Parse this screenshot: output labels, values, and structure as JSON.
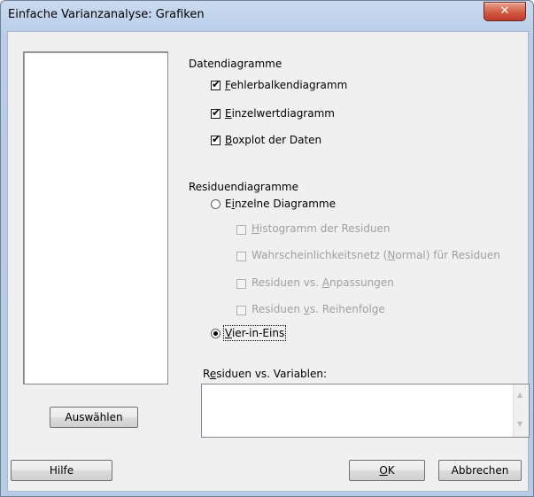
{
  "window": {
    "title": "Einfache Varianzanalyse: Grafiken",
    "close_glyph": "✕"
  },
  "data_plots": {
    "heading": "Datendiagramme",
    "items": [
      {
        "mnemonic": "F",
        "rest": "ehlerbalkendiagramm",
        "checked": true
      },
      {
        "mnemonic": "E",
        "rest": "inzelwertdiagramm",
        "checked": true
      },
      {
        "mnemonic": "B",
        "rest": "oxplot der Daten",
        "checked": true
      }
    ]
  },
  "residual_plots": {
    "heading": "Residuendiagramme",
    "individual": {
      "mnemonic": "i",
      "pre": "E",
      "rest": "nzelne Diagramme",
      "selected": false
    },
    "sub_items": [
      {
        "pre": "",
        "mnemonic": "H",
        "rest": "istogramm der Residuen",
        "checked": false,
        "enabled": false
      },
      {
        "pre": "Wahrscheinlichkeitsnetz (",
        "mnemonic": "N",
        "rest": "ormal) für Residuen",
        "checked": false,
        "enabled": false
      },
      {
        "pre": "Residuen vs. ",
        "mnemonic": "A",
        "rest": "npassungen",
        "checked": false,
        "enabled": false
      },
      {
        "pre": "Residuen ",
        "mnemonic": "v",
        "rest": "s. Reihenfolge",
        "checked": false,
        "enabled": false
      }
    ],
    "four_in_one": {
      "mnemonic": "V",
      "rest": "ier-in-Eins",
      "selected": true
    }
  },
  "residuals_vs_vars": {
    "pre": "R",
    "mnemonic": "e",
    "rest": "siduen vs. Variablen:",
    "value": ""
  },
  "buttons": {
    "select": "Auswählen",
    "help": "Hilfe",
    "ok_mnemonic": "O",
    "ok_rest": "K",
    "cancel": "Abbrechen"
  },
  "check_glyph": "✔"
}
